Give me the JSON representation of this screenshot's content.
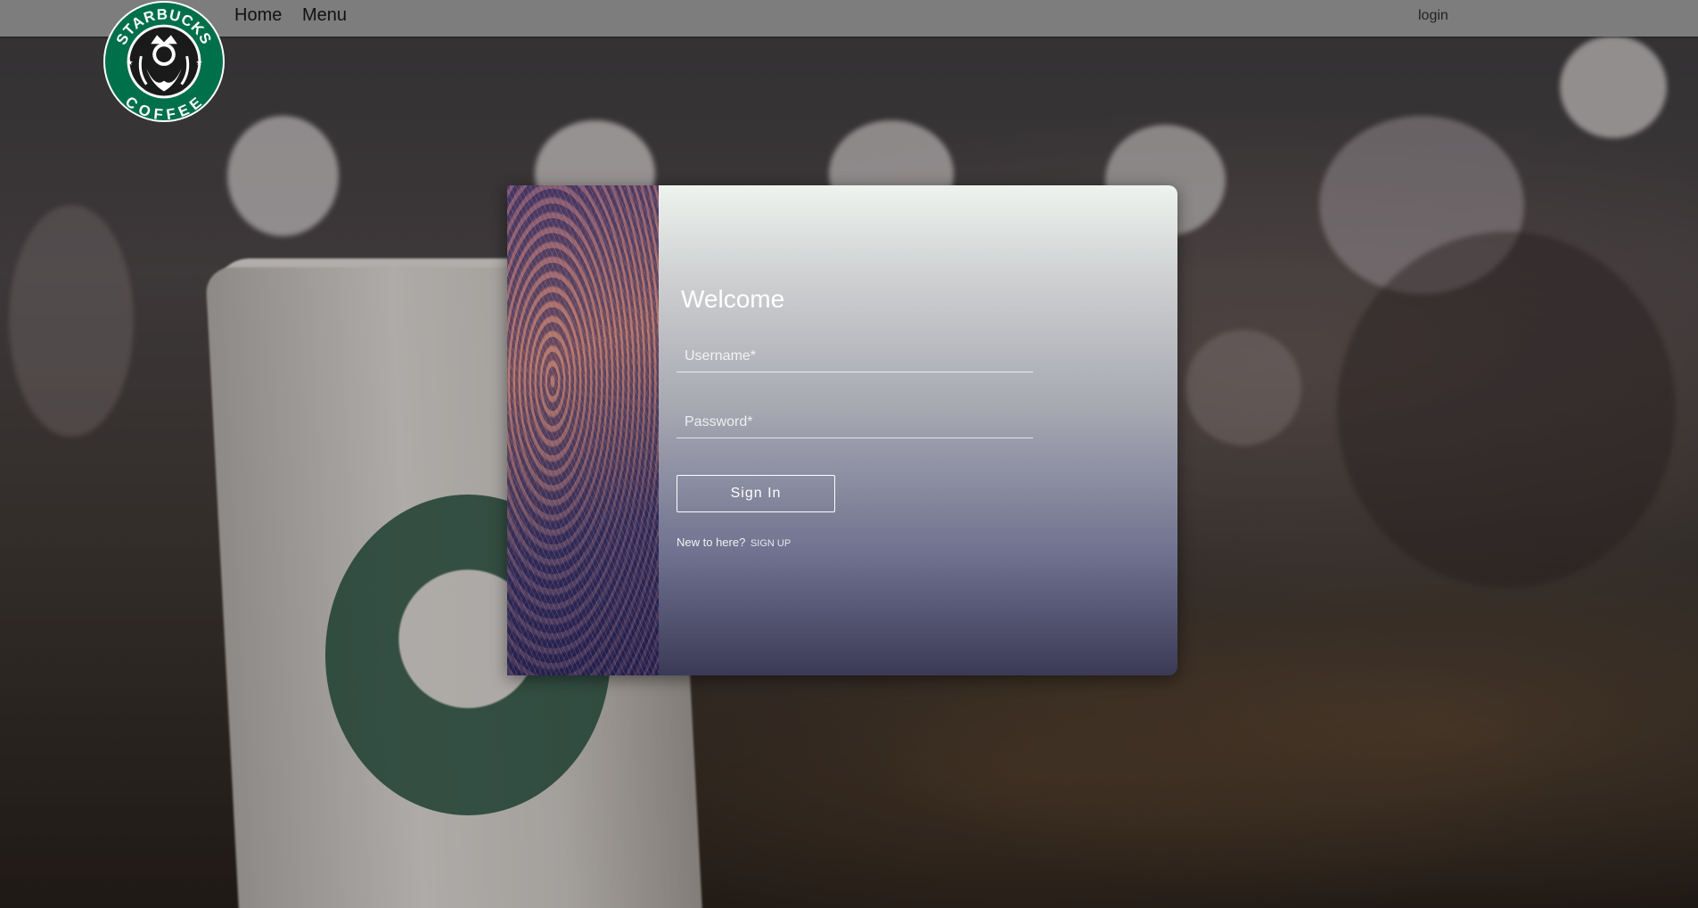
{
  "nav": {
    "home_label": "Home",
    "menu_label": "Menu",
    "login_label": "login"
  },
  "brand": {
    "logo_text_top": "STARBUCKS",
    "logo_text_bottom": "COFFEE",
    "logo_color": "#00704A"
  },
  "login_card": {
    "title": "Welcome",
    "username_placeholder": "Username*",
    "password_placeholder": "Password*",
    "signin_label": "Sign In",
    "new_prompt": "New to here?",
    "signup_label": "SIGN UP"
  },
  "colors": {
    "navbar_bg": "#808080",
    "card_gradient_top": "#eef3ef",
    "card_gradient_bottom": "#3b3a56",
    "text_on_card": "#ffffff"
  }
}
